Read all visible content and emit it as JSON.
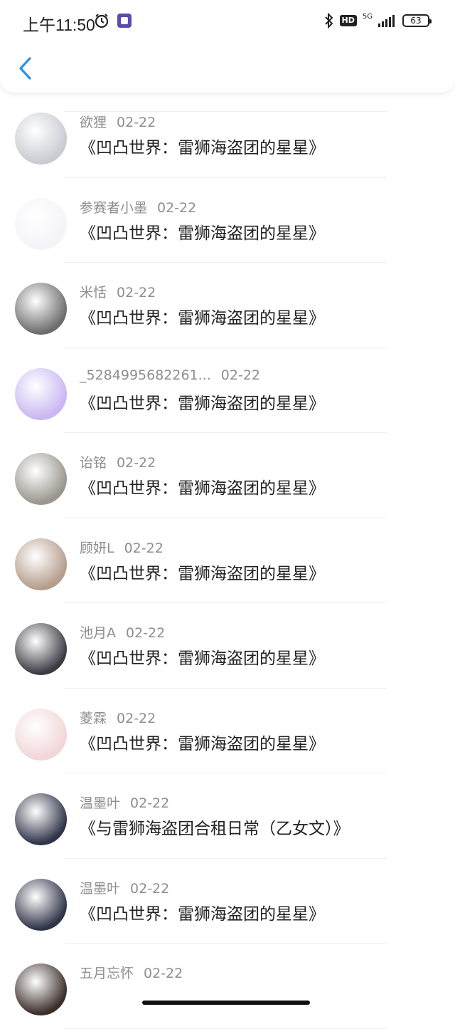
{
  "status": {
    "time": "上午11:50",
    "network": "5G",
    "hd": "HD",
    "battery": "63"
  },
  "list": [
    {
      "name": "欲狸",
      "date": "02-22",
      "title": "《凹凸世界：雷狮海盗团的星星》",
      "avatar_color": "#c9cbd2"
    },
    {
      "name": "参赛者小墨",
      "date": "02-22",
      "title": "《凹凸世界：雷狮海盗团的星星》",
      "avatar_color": "#f4f4f8"
    },
    {
      "name": "米恬",
      "date": "02-22",
      "title": "《凹凸世界：雷狮海盗团的星星》",
      "avatar_color": "#6d6d6d"
    },
    {
      "name": "_5284995682261...",
      "date": "02-22",
      "title": "《凹凸世界：雷狮海盗团的星星》",
      "avatar_color": "#c9b7f2"
    },
    {
      "name": "诒铭",
      "date": "02-22",
      "title": "《凹凸世界：雷狮海盗团的星星》",
      "avatar_color": "#9a968e"
    },
    {
      "name": "顾妍L",
      "date": "02-22",
      "title": "《凹凸世界：雷狮海盗团的星星》",
      "avatar_color": "#b59d8c"
    },
    {
      "name": "池月A",
      "date": "02-22",
      "title": "《凹凸世界：雷狮海盗团的星星》",
      "avatar_color": "#3c3b44"
    },
    {
      "name": "菱霖",
      "date": "02-22",
      "title": "《凹凸世界：雷狮海盗团的星星》",
      "avatar_color": "#f2d6d8"
    },
    {
      "name": "温墨叶",
      "date": "02-22",
      "title": "《与雷狮海盗团合租日常（乙女文）》",
      "avatar_color": "#2f3448"
    },
    {
      "name": "温墨叶",
      "date": "02-22",
      "title": "《凹凸世界：雷狮海盗团的星星》",
      "avatar_color": "#2f3448"
    },
    {
      "name": "五月忘怀",
      "date": "02-22",
      "title": "",
      "avatar_color": "#3b2e2a"
    }
  ]
}
